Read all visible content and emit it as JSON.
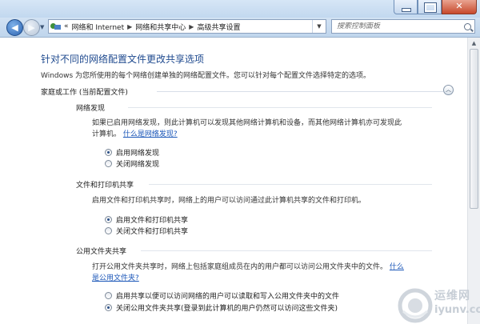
{
  "address_bar": {
    "breadcrumb_prefix": "«",
    "breadcrumbs": [
      "网络和 Internet",
      "网络和共享中心",
      "高级共享设置"
    ],
    "search_placeholder": "搜索控制面板"
  },
  "page": {
    "title": "针对不同的网络配置文件更改共享选项",
    "description": "Windows 为您所使用的每个网络创建单独的网络配置文件。您可以针对每个配置文件选择特定的选项。",
    "profile_group": "家庭或工作 (当前配置文件)"
  },
  "sections": {
    "discovery": {
      "title": "网络发现",
      "text_line1": "如果已启用网络发现，则此计算机可以发现其他网络计算机和设备，而其他网络计算机亦可发现此",
      "text_line2": "计算机。",
      "link": "什么是网络发现?",
      "option_on": "启用网络发现",
      "option_off": "关闭网络发现",
      "selected": "on"
    },
    "file_print": {
      "title": "文件和打印机共享",
      "text": "启用文件和打印机共享时，网络上的用户可以访问通过此计算机共享的文件和打印机。",
      "option_on": "启用文件和打印机共享",
      "option_off": "关闭文件和打印机共享",
      "selected": "on"
    },
    "public_folder": {
      "title": "公用文件夹共享",
      "text_line1": "打开公用文件夹共享时，网络上包括家庭组成员在内的用户都可以访问公用文件夹中的文件。",
      "link_part1": "什么",
      "link_part2": "是公用文件夹?",
      "option_on": "启用共享以便可以访问网络的用户可以读取和写入公用文件夹中的文件",
      "option_off": "关闭公用文件夹共享(登录到此计算机的用户仍然可以访问这些文件夹)",
      "selected": "off"
    }
  },
  "watermark": {
    "line1": "运维网",
    "line2": "iyunv.com"
  },
  "colors": {
    "title_blue": "#1f4a8f",
    "link_blue": "#1a56b8",
    "chrome_blue": "#c2d8ef"
  }
}
